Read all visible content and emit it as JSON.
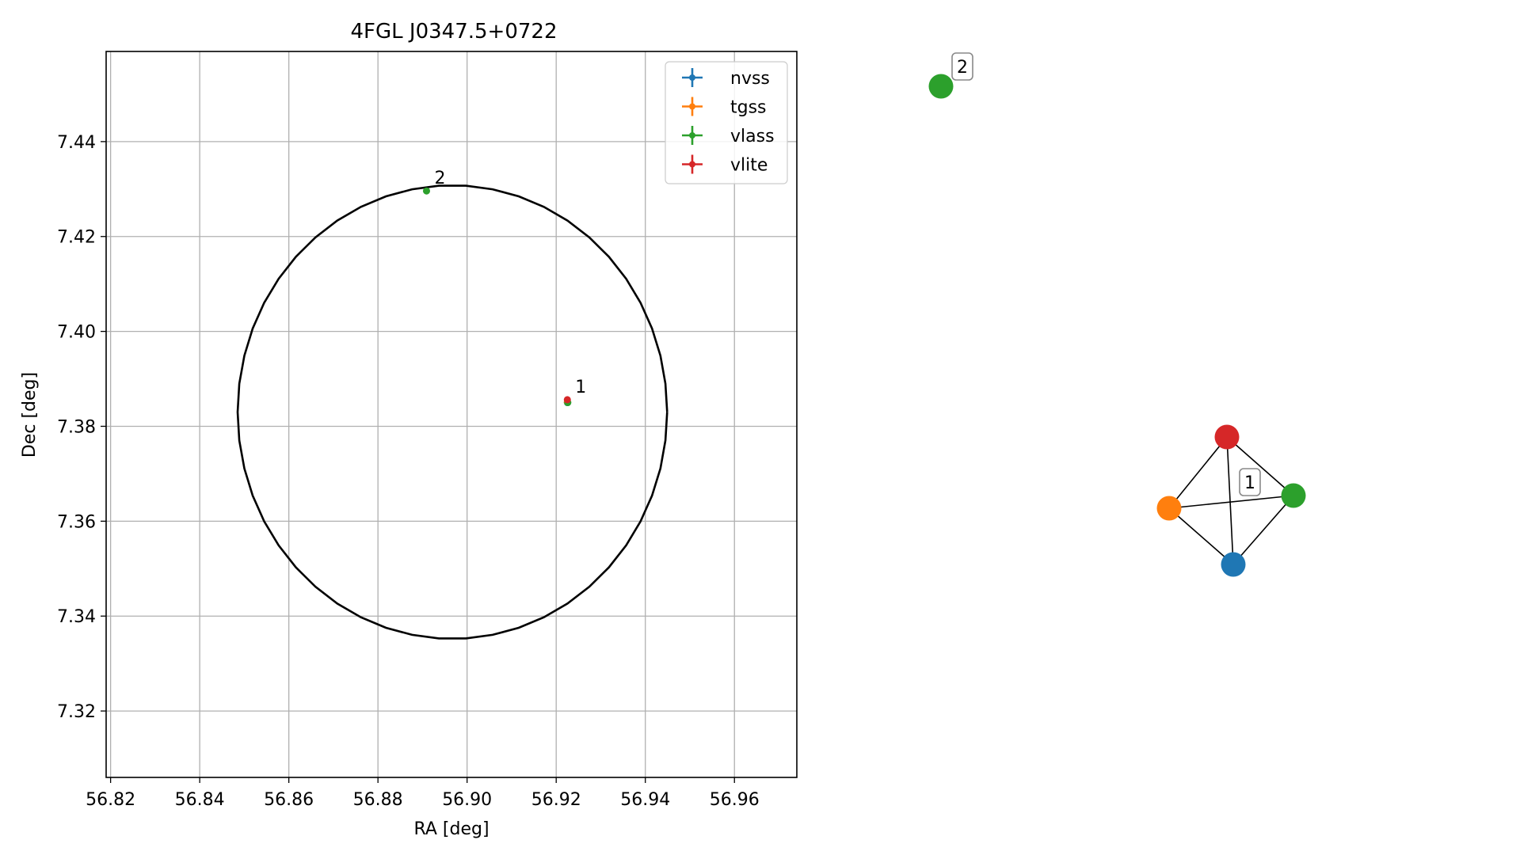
{
  "chart_data": [
    {
      "type": "scatter",
      "title": "4FGL J0347.5+0722",
      "xlabel": "RA [deg]",
      "ylabel": "Dec [deg]",
      "xlim": [
        56.819,
        56.974
      ],
      "ylim": [
        7.306,
        7.459
      ],
      "grid": true,
      "legend_position": "top-right",
      "xticks": [
        "56.82",
        "56.84",
        "56.86",
        "56.88",
        "56.90",
        "56.92",
        "56.94",
        "56.96"
      ],
      "yticks": [
        "7.32",
        "7.34",
        "7.36",
        "7.38",
        "7.40",
        "7.42",
        "7.44"
      ],
      "series": [
        {
          "name": "nvss",
          "color": "#1f77b4",
          "points": [
            {
              "x": 56.9225,
              "y": 7.385
            }
          ]
        },
        {
          "name": "tgss",
          "color": "#ff7f0e",
          "points": [
            {
              "x": 56.9225,
              "y": 7.3851
            }
          ]
        },
        {
          "name": "vlass",
          "color": "#2ca02c",
          "points": [
            {
              "x": 56.8909,
              "y": 7.4296
            },
            {
              "x": 56.9226,
              "y": 7.385
            }
          ]
        },
        {
          "name": "vlite",
          "color": "#d62728",
          "points": [
            {
              "x": 56.9225,
              "y": 7.3856
            }
          ]
        }
      ],
      "circle": {
        "ra_center": 56.8967,
        "dec_center": 7.383,
        "radius_deg": 0.0478,
        "color": "#000000"
      },
      "annotations": [
        {
          "text": "2",
          "x": 56.8909,
          "y": 7.4296
        },
        {
          "text": "1",
          "x": 56.9225,
          "y": 7.3856
        }
      ]
    },
    {
      "type": "network",
      "clusters": [
        {
          "label": "2",
          "nodes": [
            "vlass"
          ],
          "edges": []
        },
        {
          "label": "1",
          "nodes": [
            "vlite",
            "tgss",
            "vlass",
            "nvss"
          ],
          "edges": [
            [
              "vlite",
              "tgss"
            ],
            [
              "vlite",
              "vlass"
            ],
            [
              "vlite",
              "nvss"
            ],
            [
              "tgss",
              "vlass"
            ],
            [
              "tgss",
              "nvss"
            ],
            [
              "vlass",
              "nvss"
            ]
          ]
        }
      ]
    }
  ]
}
